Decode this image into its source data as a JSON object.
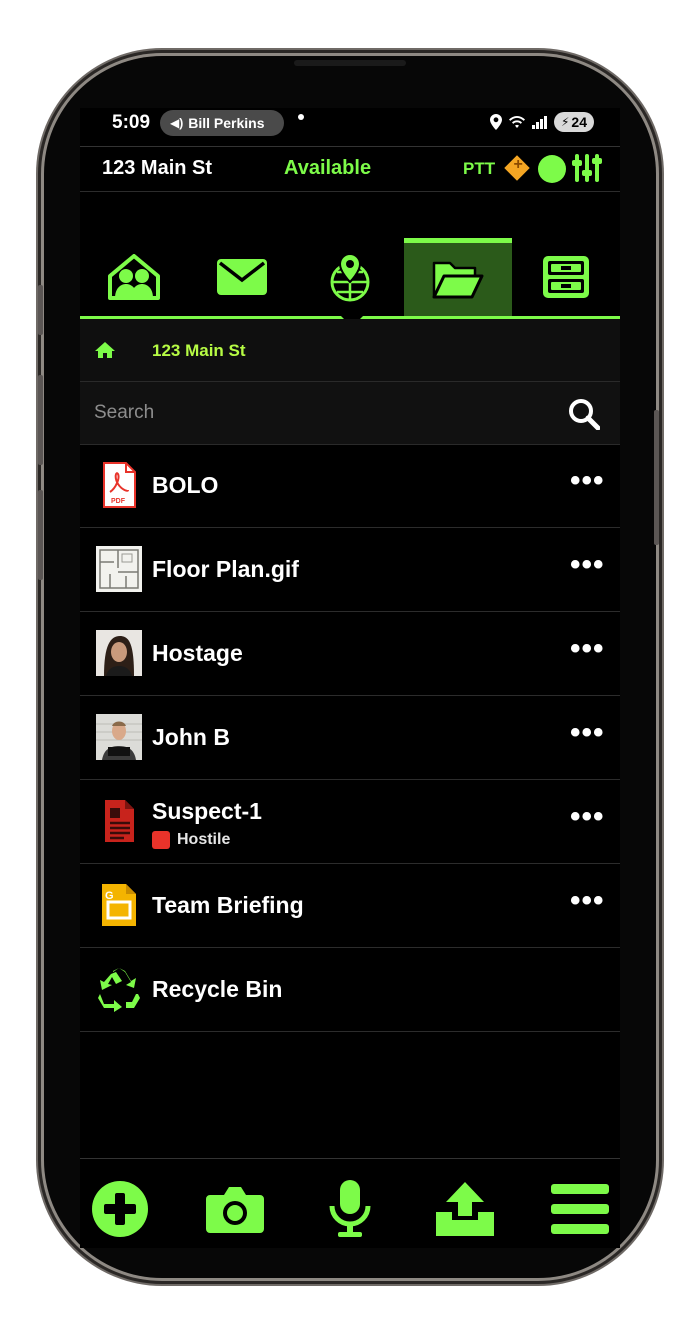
{
  "status_bar": {
    "time": "5:09",
    "call_label": "Bill Perkins",
    "battery": "24"
  },
  "header": {
    "location": "123 Main St",
    "availability": "Available",
    "ptt": "PTT"
  },
  "tabs": [
    {
      "icon": "team-icon"
    },
    {
      "icon": "mail-icon"
    },
    {
      "icon": "map-pin-globe-icon"
    },
    {
      "icon": "folder-open-icon",
      "active": true
    },
    {
      "icon": "cabinet-icon"
    }
  ],
  "breadcrumb": {
    "label": "123 Main St"
  },
  "search": {
    "placeholder": "Search"
  },
  "files": [
    {
      "name": "BOLO",
      "icon": "pdf-icon"
    },
    {
      "name": "Floor Plan.gif",
      "icon": "floorplan-thumbnail"
    },
    {
      "name": "Hostage",
      "icon": "hostage-photo-thumbnail"
    },
    {
      "name": "John B",
      "icon": "mugshot-thumbnail"
    },
    {
      "name": "Suspect-1",
      "icon": "form-doc-icon",
      "tag": "Hostile"
    },
    {
      "name": "Team Briefing",
      "icon": "slides-icon"
    },
    {
      "name": "Recycle Bin",
      "icon": "recycle-icon"
    }
  ],
  "more_label": "•••",
  "colors": {
    "accent": "#7dfb49",
    "crumb": "#b6fb44",
    "hostile": "#e8332a",
    "ptt_diamond": "#f5a623"
  }
}
